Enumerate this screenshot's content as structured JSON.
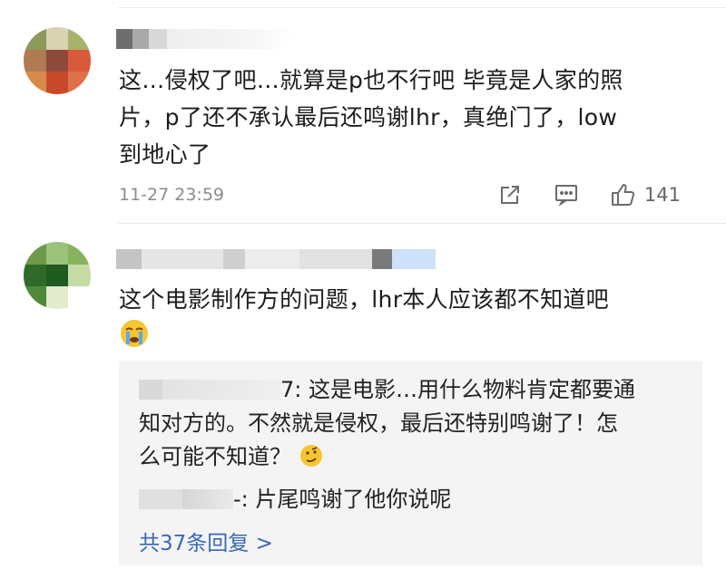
{
  "comments": [
    {
      "text_lines": [
        "这…侵权了吧…就算是p也不行吧 毕竟是人家的照",
        "片，p了还不承认最后还鸣谢lhr，真绝门了，low",
        "到地心了"
      ],
      "time": "11-27 23:59",
      "like_count": "141",
      "icons": {
        "share": "share-icon",
        "comment": "comment-icon",
        "like": "thumbs-up-icon"
      }
    },
    {
      "text_lines": [
        "这个电影制作方的问题，lhr本人应该都不知道吧"
      ],
      "emoji": "crying-face-emoji",
      "replies": [
        {
          "name_suffix": "7:",
          "text_lines": [
            "这是电影…用什么物料肯定都要通",
            "知对方的。不然就是侵权，最后还特别鸣谢了！怎",
            "么可能不知道？"
          ],
          "emoji": "thinking-face-emoji"
        },
        {
          "name_suffix": "-:",
          "text_lines": [
            "片尾鸣谢了他你说呢"
          ]
        }
      ],
      "more_replies": "共37条回复 >"
    }
  ],
  "colors": {
    "link": "#3b67b7",
    "text": "#1c1c1c",
    "meta": "#8c8c8c",
    "reply_bg": "#f4f4f4"
  }
}
